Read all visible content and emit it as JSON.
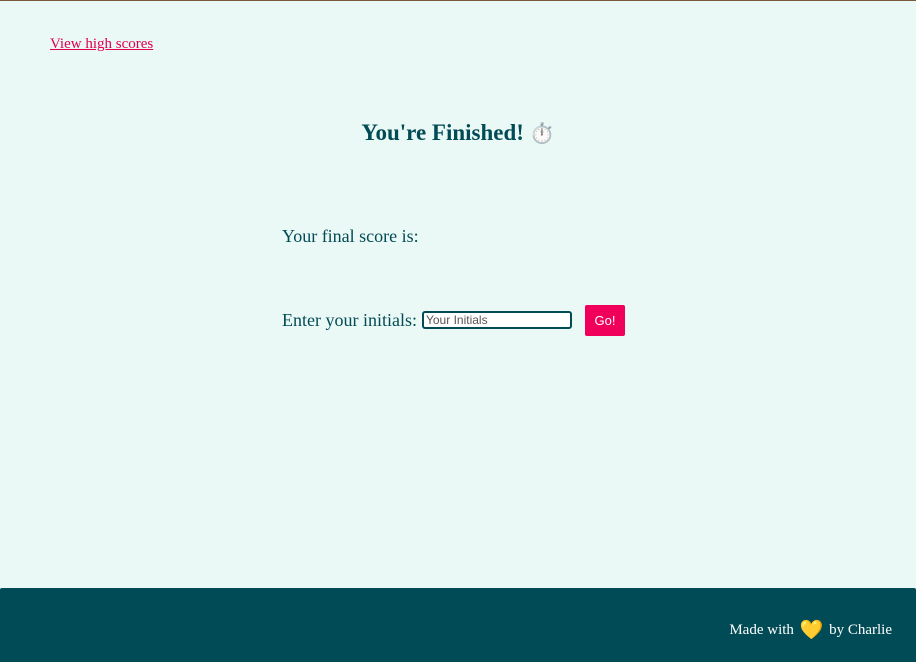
{
  "header": {
    "high_scores_link": "View high scores"
  },
  "main": {
    "title": "You're Finished!",
    "title_icon": "stopwatch-icon",
    "title_emoji": "⏱️",
    "final_score_label": "Your final score is:",
    "final_score_value": "",
    "initials_label": "Enter your initials:",
    "initials_placeholder": "Your Initials",
    "initials_value": "",
    "submit_label": "Go!"
  },
  "footer": {
    "made_with": "Made with",
    "heart_icon": "yellow-heart-icon",
    "heart_emoji": "💛",
    "by_author": "by Charlie"
  },
  "colors": {
    "background": "#ebf9f6",
    "text": "#004b55",
    "accent": "#f0005a",
    "link": "#e0004f",
    "footer": "#004b55"
  }
}
